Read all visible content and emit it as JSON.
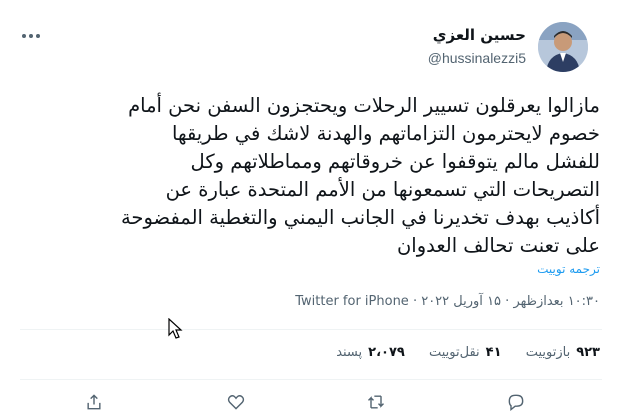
{
  "author": {
    "display_name": "حسين العزي",
    "handle": "@hussinalezzi5"
  },
  "tweet": {
    "lines": [
      "مازالوا يعرقلون تسيير الرحلات ويحتجزون السفن نحن أمام",
      "خصوم لايحترمون التزاماتهم والهدنة لاشك في طريقها",
      "للفشل مالم يتوقفوا عن خروقاتهم ومماطلاتهم وكل",
      "التصريحات التي تسمعونها من الأمم المتحدة عبارة عن",
      "أكاذيب بهدف تخديرنا في الجانب اليمني والتغطية المفضوحة",
      "على تعنت تحالف العدوان"
    ],
    "translate_label": "ترجمه توییت"
  },
  "meta": {
    "time": "۱۰:۳۰ بعدازظهر",
    "separator": " · ",
    "date": "۱۵ آوریل ۲۰۲۲",
    "source": "Twitter for iPhone"
  },
  "stats": {
    "retweets_count": "۹۲۳",
    "retweets_label": "بازتوییت",
    "quotes_count": "۴۱",
    "quotes_label": "نقل‌توییت",
    "likes_count": "۲،۰۷۹",
    "likes_label": "پسند"
  },
  "icons": {
    "reply": "reply-icon",
    "retweet": "retweet-icon",
    "like": "heart-icon",
    "share": "share-icon",
    "more": "more-options-icon"
  },
  "colors": {
    "link": "#1d9bf0",
    "text": "#0f1419",
    "secondary": "#536471",
    "divider": "#eff3f4"
  }
}
